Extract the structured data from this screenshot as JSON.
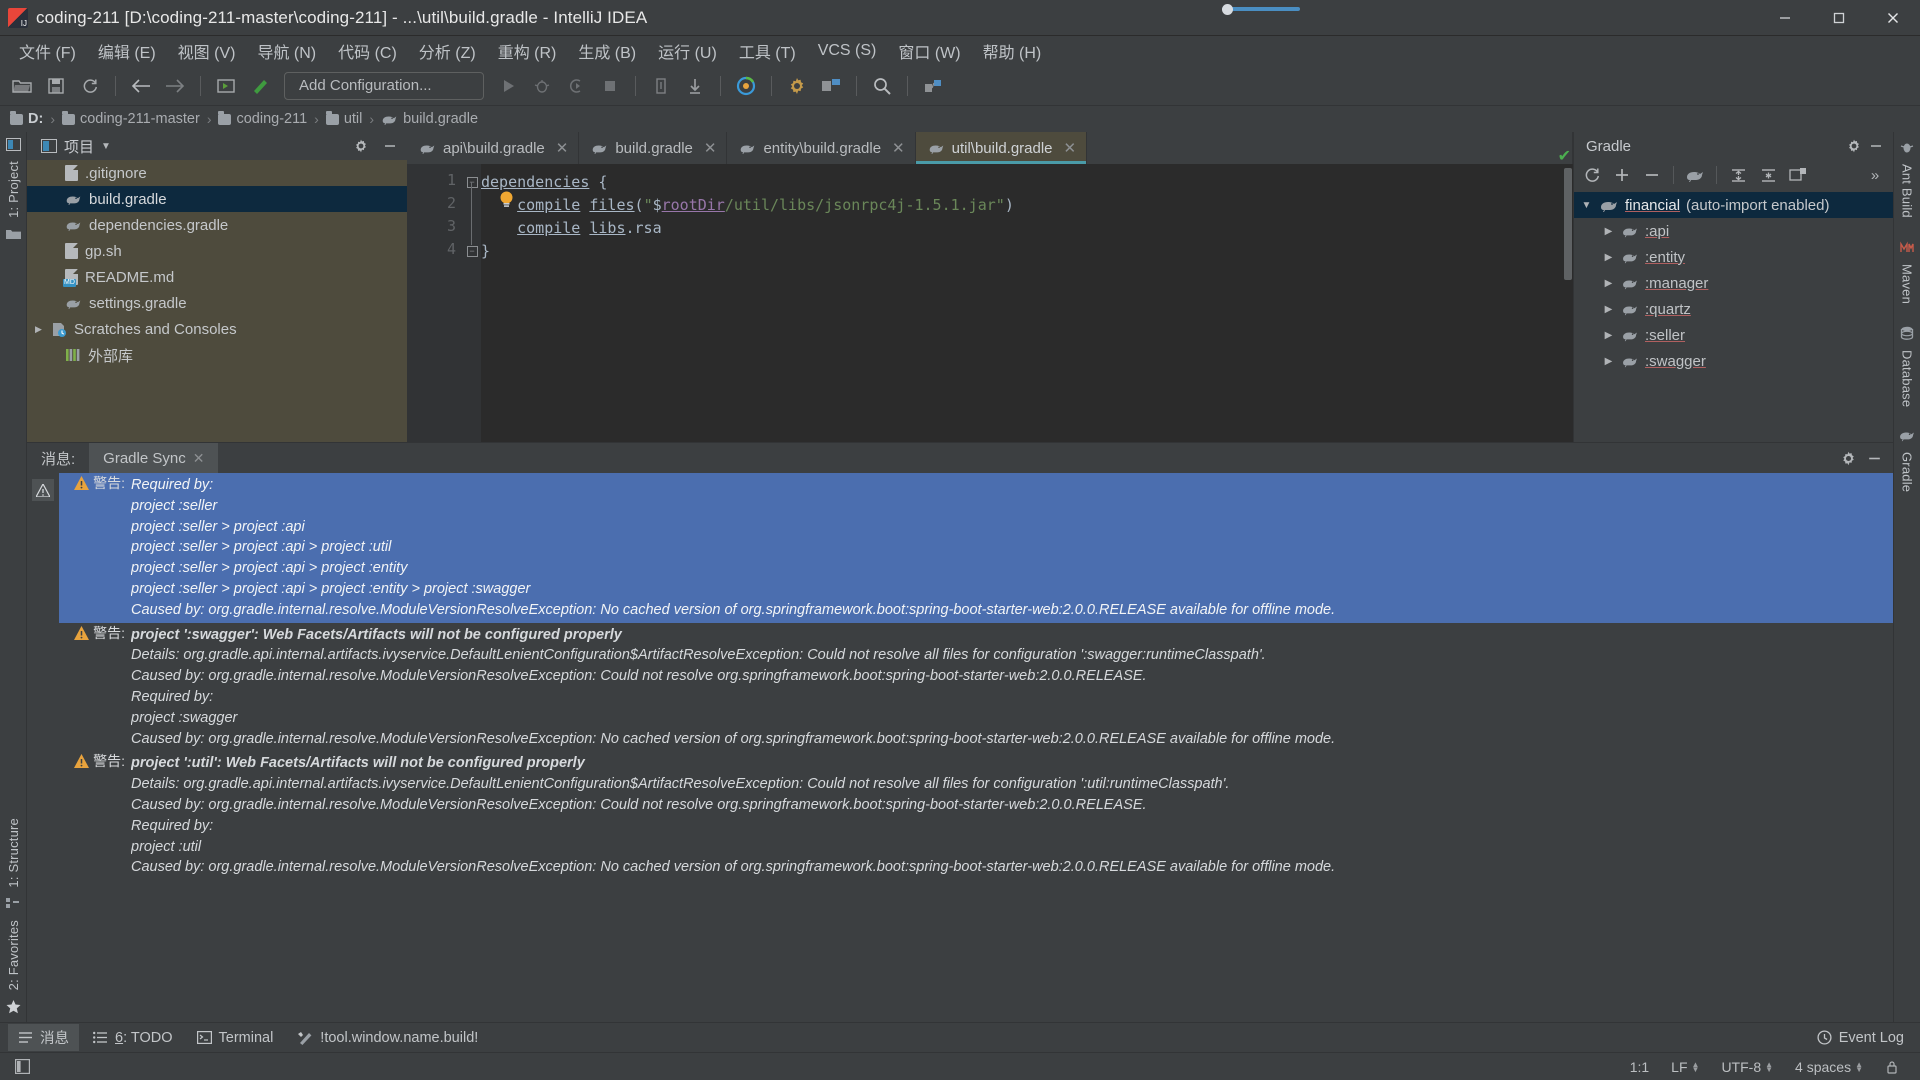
{
  "window": {
    "title": "coding-211 [D:\\coding-211-master\\coding-211] - ...\\util\\build.gradle - IntelliJ IDEA",
    "minimize_label": "—",
    "maximize_label": "❐",
    "close_label": "✕"
  },
  "menubar": {
    "items": [
      {
        "label": "文件 (F)",
        "name": "menu-file"
      },
      {
        "label": "编辑 (E)",
        "name": "menu-edit"
      },
      {
        "label": "视图 (V)",
        "name": "menu-view"
      },
      {
        "label": "导航 (N)",
        "name": "menu-navigate"
      },
      {
        "label": "代码 (C)",
        "name": "menu-code"
      },
      {
        "label": "分析 (Z)",
        "name": "menu-analyze"
      },
      {
        "label": "重构 (R)",
        "name": "menu-refactor"
      },
      {
        "label": "生成 (B)",
        "name": "menu-build"
      },
      {
        "label": "运行 (U)",
        "name": "menu-run"
      },
      {
        "label": "工具 (T)",
        "name": "menu-tools"
      },
      {
        "label": "VCS (S)",
        "name": "menu-vcs"
      },
      {
        "label": "窗口 (W)",
        "name": "menu-window"
      },
      {
        "label": "帮助 (H)",
        "name": "menu-help"
      }
    ]
  },
  "toolbar": {
    "run_configuration": "Add Configuration..."
  },
  "breadcrumb": {
    "items": [
      "D:",
      "coding-211-master",
      "coding-211",
      "util",
      "build.gradle"
    ],
    "separator": "›"
  },
  "project_panel": {
    "title": "项目",
    "items": [
      {
        "label": ".gitignore",
        "icon": "file-icon",
        "indent": 0,
        "selected": false,
        "expandable": false
      },
      {
        "label": "build.gradle",
        "icon": "gradle-icon",
        "indent": 0,
        "selected": true,
        "expandable": false
      },
      {
        "label": "dependencies.gradle",
        "icon": "gradle-icon",
        "indent": 0,
        "selected": false,
        "expandable": false
      },
      {
        "label": "gp.sh",
        "icon": "file-icon",
        "indent": 0,
        "selected": false,
        "expandable": false
      },
      {
        "label": "README.md",
        "icon": "markdown-icon",
        "indent": 0,
        "selected": false,
        "expandable": false
      },
      {
        "label": "settings.gradle",
        "icon": "gradle-icon",
        "indent": 0,
        "selected": false,
        "expandable": false
      },
      {
        "label": "Scratches and Consoles",
        "icon": "scratches-icon",
        "indent": 0,
        "selected": false,
        "expandable": true
      },
      {
        "label": "外部库",
        "icon": "library-icon",
        "indent": 0,
        "selected": false,
        "expandable": false
      }
    ]
  },
  "editor": {
    "tabs": [
      {
        "label": "api\\build.gradle",
        "active": false
      },
      {
        "label": "build.gradle",
        "active": false
      },
      {
        "label": "entity\\build.gradle",
        "active": false
      },
      {
        "label": "util\\build.gradle",
        "active": true
      }
    ],
    "line_numbers": [
      "1",
      "2",
      "3",
      "4"
    ],
    "code": [
      {
        "parts": [
          {
            "t": "dependencies",
            "c": "kw"
          },
          {
            "t": " {",
            "c": "plain"
          }
        ]
      },
      {
        "parts": [
          {
            "t": "    ",
            "c": "plain"
          },
          {
            "t": "compile",
            "c": "kw"
          },
          {
            "t": " ",
            "c": "plain"
          },
          {
            "t": "files",
            "c": "kw"
          },
          {
            "t": "(",
            "c": "plain"
          },
          {
            "t": "\"",
            "c": "str"
          },
          {
            "t": "$",
            "c": "plain"
          },
          {
            "t": "rootDir",
            "c": "var"
          },
          {
            "t": "/util/libs/jsonrpc4j-1.5.1.jar\"",
            "c": "str"
          },
          {
            "t": ")",
            "c": "plain"
          }
        ]
      },
      {
        "parts": [
          {
            "t": "    ",
            "c": "plain"
          },
          {
            "t": "compile",
            "c": "kw"
          },
          {
            "t": " ",
            "c": "plain"
          },
          {
            "t": "libs",
            "c": "kw"
          },
          {
            "t": ".rsa",
            "c": "plain"
          }
        ]
      },
      {
        "parts": [
          {
            "t": "}",
            "c": "plain"
          }
        ]
      }
    ]
  },
  "gradle_panel": {
    "title": "Gradle",
    "root": {
      "name": "financial",
      "suffix": " (auto-import enabled)"
    },
    "modules": [
      ":api",
      ":entity",
      ":manager",
      ":quartz",
      ":seller",
      ":swagger"
    ]
  },
  "messages": {
    "tabs": [
      {
        "label": "消息:",
        "closable": false,
        "active": false
      },
      {
        "label": "Gradle Sync",
        "closable": true,
        "active": true
      }
    ],
    "warning_label": "警告:",
    "groups": [
      {
        "selected": true,
        "lines": [
          {
            "text": "Required by:",
            "bold": false
          },
          {
            "text": "project :seller",
            "bold": false
          },
          {
            "text": "project :seller > project :api",
            "bold": false
          },
          {
            "text": "project :seller > project :api > project :util",
            "bold": false
          },
          {
            "text": "project :seller > project :api > project :entity",
            "bold": false
          },
          {
            "text": "project :seller > project :api > project :entity > project :swagger",
            "bold": false
          },
          {
            "text": "Caused by: org.gradle.internal.resolve.ModuleVersionResolveException: No cached version of org.springframework.boot:spring-boot-starter-web:2.0.0.RELEASE available for offline mode.",
            "bold": false
          }
        ]
      },
      {
        "selected": false,
        "lines": [
          {
            "text": "project ':swagger': Web Facets/Artifacts will not be configured properly",
            "bold": true
          },
          {
            "text": "Details: org.gradle.api.internal.artifacts.ivyservice.DefaultLenientConfiguration$ArtifactResolveException: Could not resolve all files for configuration ':swagger:runtimeClasspath'.",
            "bold": false
          },
          {
            "text": "Caused by: org.gradle.internal.resolve.ModuleVersionResolveException: Could not resolve org.springframework.boot:spring-boot-starter-web:2.0.0.RELEASE.",
            "bold": false
          },
          {
            "text": "Required by:",
            "bold": false
          },
          {
            "text": "project :swagger",
            "bold": false
          },
          {
            "text": "Caused by: org.gradle.internal.resolve.ModuleVersionResolveException: No cached version of org.springframework.boot:spring-boot-starter-web:2.0.0.RELEASE available for offline mode.",
            "bold": false
          }
        ]
      },
      {
        "selected": false,
        "lines": [
          {
            "text": "project ':util': Web Facets/Artifacts will not be configured properly",
            "bold": true
          },
          {
            "text": "Details: org.gradle.api.internal.artifacts.ivyservice.DefaultLenientConfiguration$ArtifactResolveException: Could not resolve all files for configuration ':util:runtimeClasspath'.",
            "bold": false
          },
          {
            "text": "Caused by: org.gradle.internal.resolve.ModuleVersionResolveException: Could not resolve org.springframework.boot:spring-boot-starter-web:2.0.0.RELEASE.",
            "bold": false
          },
          {
            "text": "Required by:",
            "bold": false
          },
          {
            "text": "project :util",
            "bold": false
          },
          {
            "text": "Caused by: org.gradle.internal.resolve.ModuleVersionResolveException: No cached version of org.springframework.boot:spring-boot-starter-web:2.0.0.RELEASE available for offline mode.",
            "bold": false
          }
        ]
      }
    ]
  },
  "bottom_bar": {
    "buttons": [
      {
        "label": "消息",
        "icon": "messages-icon",
        "active": true,
        "prefix": ""
      },
      {
        "label": ": TODO",
        "icon": "todo-icon",
        "active": false,
        "prefix": "6"
      },
      {
        "label": "Terminal",
        "icon": "terminal-icon",
        "active": false,
        "prefix": ""
      },
      {
        "label": "!tool.window.name.build!",
        "icon": "build-icon",
        "active": false,
        "prefix": ""
      }
    ],
    "event_log": "Event Log"
  },
  "left_rail": {
    "items": [
      "1: Project",
      "1: Structure",
      "2: Favorites"
    ]
  },
  "right_rail": {
    "items": [
      "Ant Build",
      "Maven",
      "Database",
      "Gradle"
    ]
  },
  "statusbar": {
    "position": "1:1",
    "line_separator": "LF",
    "encoding": "UTF-8",
    "indent": "4 spaces"
  }
}
